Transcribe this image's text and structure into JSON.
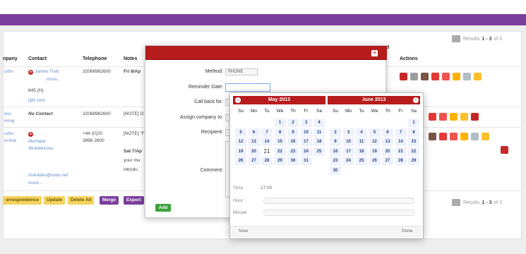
{
  "header": {
    "partial_title": "ed"
  },
  "pagination": {
    "prefix": "Results",
    "range": "1 - 3",
    "suffix": "of 3"
  },
  "table": {
    "headers": {
      "company": "npany",
      "contact": "Contact",
      "telephone": "Telephone",
      "notes": "Notes",
      "actions": "Actions"
    },
    "rows": [
      {
        "company": [
          "urbo"
        ],
        "contact": [
          "James Trott",
          "more...",
          "845 (H)",
          "j@t.com"
        ],
        "telephone": "32068962600",
        "notes": "Fri 8/Ap"
      },
      {
        "company": [
          "ess",
          "ering"
        ],
        "contact": [
          "No Contact"
        ],
        "telephone": "32068962600",
        "notes": "[NOTE] O"
      },
      {
        "company": [
          "urbo",
          "ervice"
        ],
        "contact": [
          "Merhawi",
          "Woldekiross",
          "mwolden@urbo.net",
          "more..."
        ],
        "telephone": [
          "+44 (0)20",
          "3896 2600"
        ],
        "notes": [
          "[NOTE] \"F",
          "Sat 7/Ap",
          "your mu",
          "introdu"
        ]
      }
    ]
  },
  "bottom_buttons": {
    "correspondence": "orrespondence",
    "update": "Update",
    "delete_all": "Delete All",
    "merge": "Merge",
    "export": "Export"
  },
  "modal": {
    "close_label": "×",
    "fields": {
      "method": "Method:",
      "method_value": "PHONE",
      "reminder_date": "Reminder Date:",
      "call_back_for": "Call back for:",
      "assign_company": "Assign company to:",
      "recipient": "Recipient:",
      "comment": "Comment:"
    },
    "add_label": "Add"
  },
  "datepicker": {
    "months": [
      "May 2013",
      "June 2013"
    ],
    "weekdays": [
      "Su",
      "Mo",
      "Tu",
      "We",
      "Th",
      "Fr",
      "Sa"
    ],
    "may_days": [
      "1",
      "2",
      "3",
      "4",
      "5",
      "6",
      "7",
      "8",
      "9",
      "10",
      "11",
      "12",
      "13",
      "14",
      "15",
      "16",
      "17",
      "18",
      "19",
      "20",
      "21",
      "22",
      "23",
      "24",
      "25",
      "26",
      "27",
      "28",
      "29",
      "30",
      "31"
    ],
    "june_days": [
      "1",
      "2",
      "3",
      "4",
      "5",
      "6",
      "7",
      "8",
      "9",
      "10",
      "11",
      "12",
      "13",
      "14",
      "15",
      "16",
      "17",
      "18",
      "19",
      "20",
      "21",
      "22",
      "23",
      "24",
      "25",
      "26",
      "27",
      "28",
      "29",
      "30"
    ],
    "today": "21",
    "time_label": "Time",
    "time_value": "17:00",
    "hour_label": "Hour",
    "minute_label": "Minute",
    "now_label": "Now",
    "done_label": "Done",
    "prev_icon": "‹",
    "next_icon": "›"
  },
  "colors": {
    "accent_red": "#b71c1c",
    "purple": "#7a3f9c",
    "yellow_button": "#f4d35e",
    "add_green": "#3aa33a"
  }
}
